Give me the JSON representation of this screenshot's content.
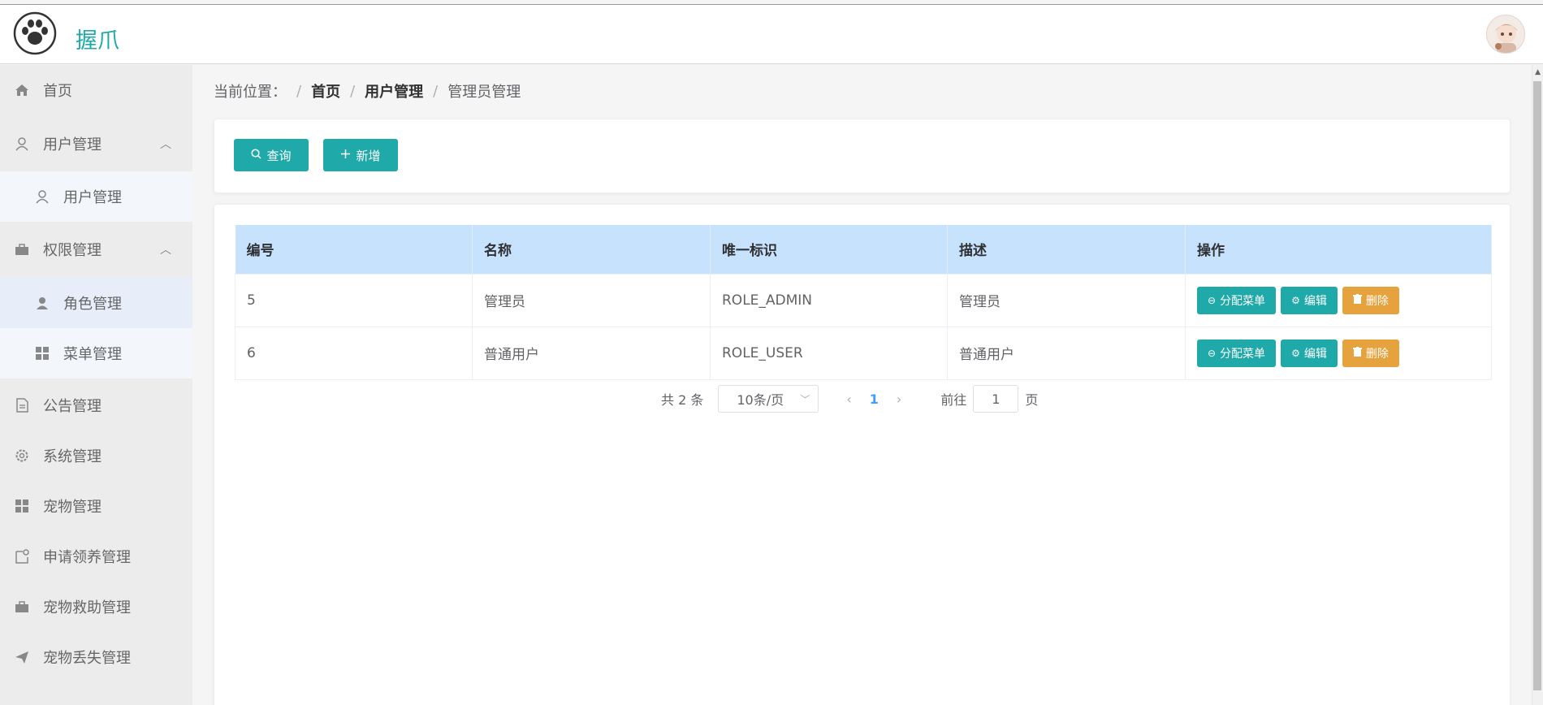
{
  "header": {
    "title": "握爪"
  },
  "sidebar": {
    "items": [
      {
        "label": "首页",
        "icon": "home-icon"
      },
      {
        "label": "用户管理",
        "icon": "user-icon",
        "expanded": true
      },
      {
        "label": "用户管理",
        "icon": "user-icon",
        "sub": true
      },
      {
        "label": "权限管理",
        "icon": "briefcase-icon",
        "expanded": true
      },
      {
        "label": "角色管理",
        "icon": "user-solid-icon",
        "sub": true,
        "active": true
      },
      {
        "label": "菜单管理",
        "icon": "grid-icon",
        "sub": true
      },
      {
        "label": "公告管理",
        "icon": "document-icon"
      },
      {
        "label": "系统管理",
        "icon": "gear-icon"
      },
      {
        "label": "宠物管理",
        "icon": "grid-icon"
      },
      {
        "label": "申请领养管理",
        "icon": "notebook-icon"
      },
      {
        "label": "宠物救助管理",
        "icon": "briefcase-icon"
      },
      {
        "label": "宠物丢失管理",
        "icon": "send-icon"
      }
    ]
  },
  "breadcrumb": {
    "prefix": "当前位置：",
    "items": [
      "首页",
      "用户管理",
      "管理员管理"
    ]
  },
  "toolbar": {
    "query_label": "查询",
    "add_label": "新增"
  },
  "table": {
    "columns": [
      "编号",
      "名称",
      "唯一标识",
      "描述",
      "操作"
    ],
    "rows": [
      {
        "id": "5",
        "name": "管理员",
        "key": "ROLE_ADMIN",
        "desc": "管理员"
      },
      {
        "id": "6",
        "name": "普通用户",
        "key": "ROLE_USER",
        "desc": "普通用户"
      }
    ],
    "actions": {
      "assign": "分配菜单",
      "edit": "编辑",
      "delete": "删除"
    }
  },
  "pagination": {
    "total_text": "共 2 条",
    "page_size": "10条/页",
    "current_page": "1",
    "goto_prefix": "前往",
    "goto_value": "1",
    "goto_suffix": "页"
  },
  "colors": {
    "accent": "#20a9a9",
    "danger": "#e6a23c",
    "header_bg": "#c6e2fd"
  }
}
